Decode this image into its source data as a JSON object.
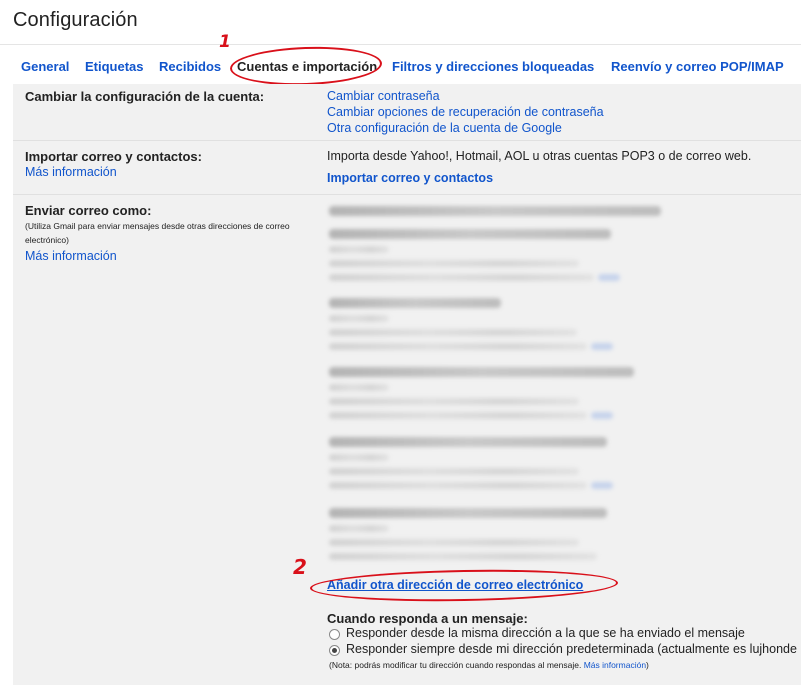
{
  "page": {
    "title": "Configuración"
  },
  "tabs": [
    {
      "label": "General"
    },
    {
      "label": "Etiquetas"
    },
    {
      "label": "Recibidos"
    },
    {
      "label": "Cuentas e importación"
    },
    {
      "label": "Filtros y direcciones bloqueadas"
    },
    {
      "label": "Reenvío y correo POP/IMAP"
    }
  ],
  "active_tab": "Cuentas e importación",
  "account_settings": {
    "label": "Cambiar la configuración de la cuenta:",
    "links": [
      "Cambiar contraseña",
      "Cambiar opciones de recuperación de contraseña",
      "Otra configuración de la cuenta de Google"
    ]
  },
  "import": {
    "label": "Importar correo y contactos:",
    "more_info": "Más información",
    "description": "Importa desde Yahoo!, Hotmail, AOL u otras cuentas POP3 o de correo web.",
    "action": "Importar correo y contactos"
  },
  "send_as": {
    "label": "Enviar correo como:",
    "note": "(Utiliza Gmail para enviar mensajes desde otras direcciones de correo electrónico)",
    "more_info": "Más información",
    "add_link": "Añadir otra dirección de correo electrónico",
    "reply": {
      "heading": "Cuando responda a un mensaje:",
      "options": [
        {
          "label": "Responder desde la misma dirección a la que se ha enviado el mensaje",
          "selected": false
        },
        {
          "label": "Responder siempre desde mi dirección predeterminada (actualmente es lujhonde",
          "selected": true
        }
      ],
      "note": "(Nota: podrás modificar tu dirección cuando respondas al mensaje.",
      "note_link": "Más información",
      "note_end": ")"
    }
  },
  "annotations": {
    "step1": "1",
    "step2": "2",
    "color": "#d9101a"
  },
  "colors": {
    "link": "#1155cc",
    "background": "#f1f1f1",
    "text": "#222222"
  }
}
